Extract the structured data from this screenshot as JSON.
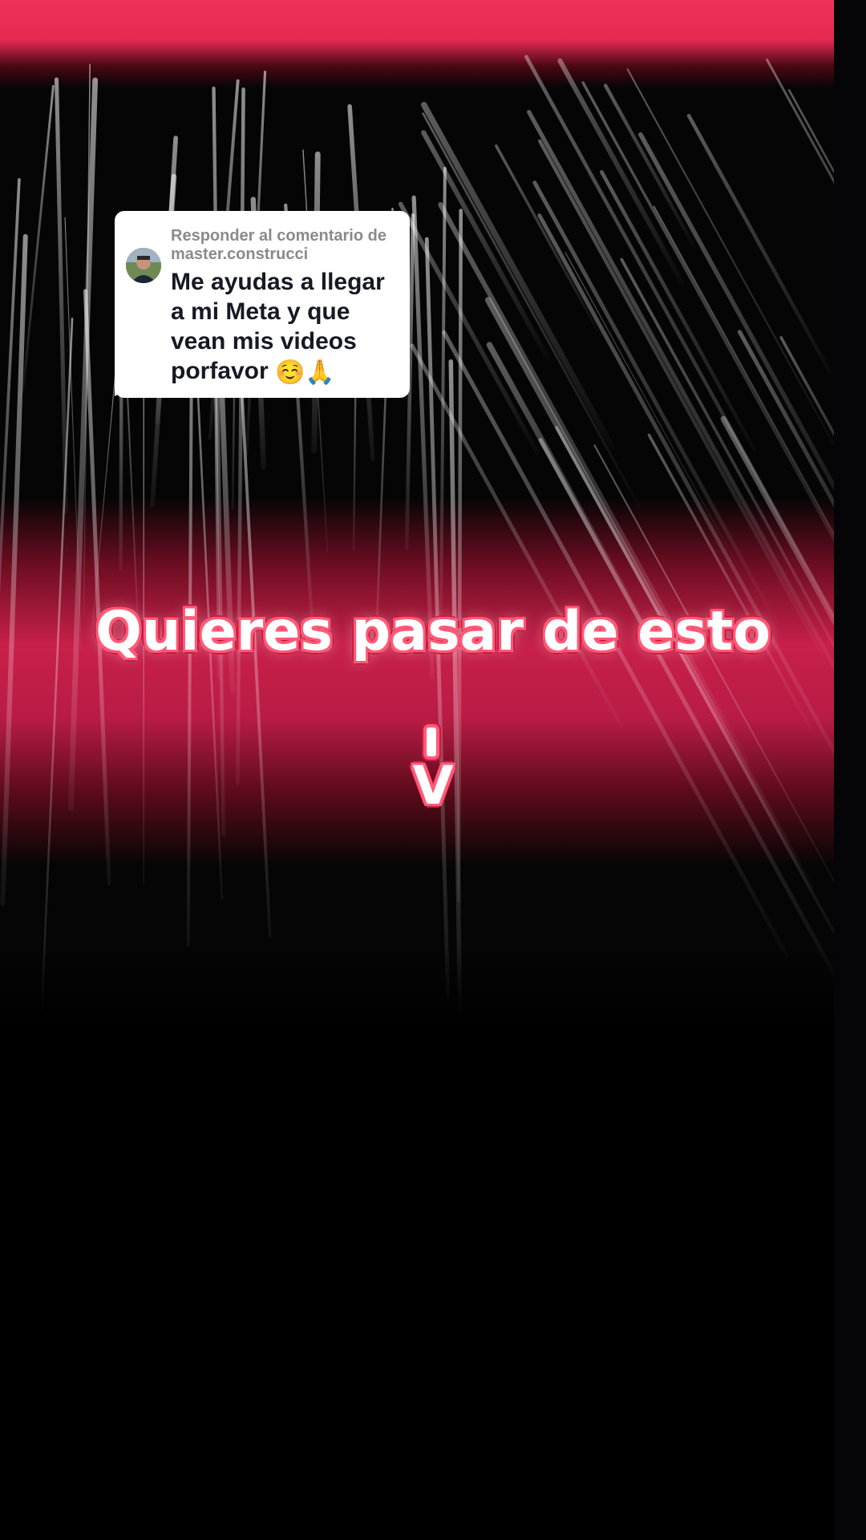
{
  "reply": {
    "header_label": "Responder al comentario de",
    "username": "master.construcci",
    "comment_text": "Me ayudas a llegar a mi Meta y que vean mis videos porfavor",
    "emojis": "☺️🙏"
  },
  "overlay": {
    "caption": "Quieres pasar de esto",
    "arrow_top": "|",
    "arrow_bottom": "V"
  },
  "colors": {
    "accent": "#e52a52",
    "caption_outline": "#ff5a78",
    "bubble_bg": "#ffffff",
    "header_text": "#8a8a8e",
    "comment_text": "#161823"
  },
  "icons": {
    "avatar": "user-avatar-photo"
  }
}
